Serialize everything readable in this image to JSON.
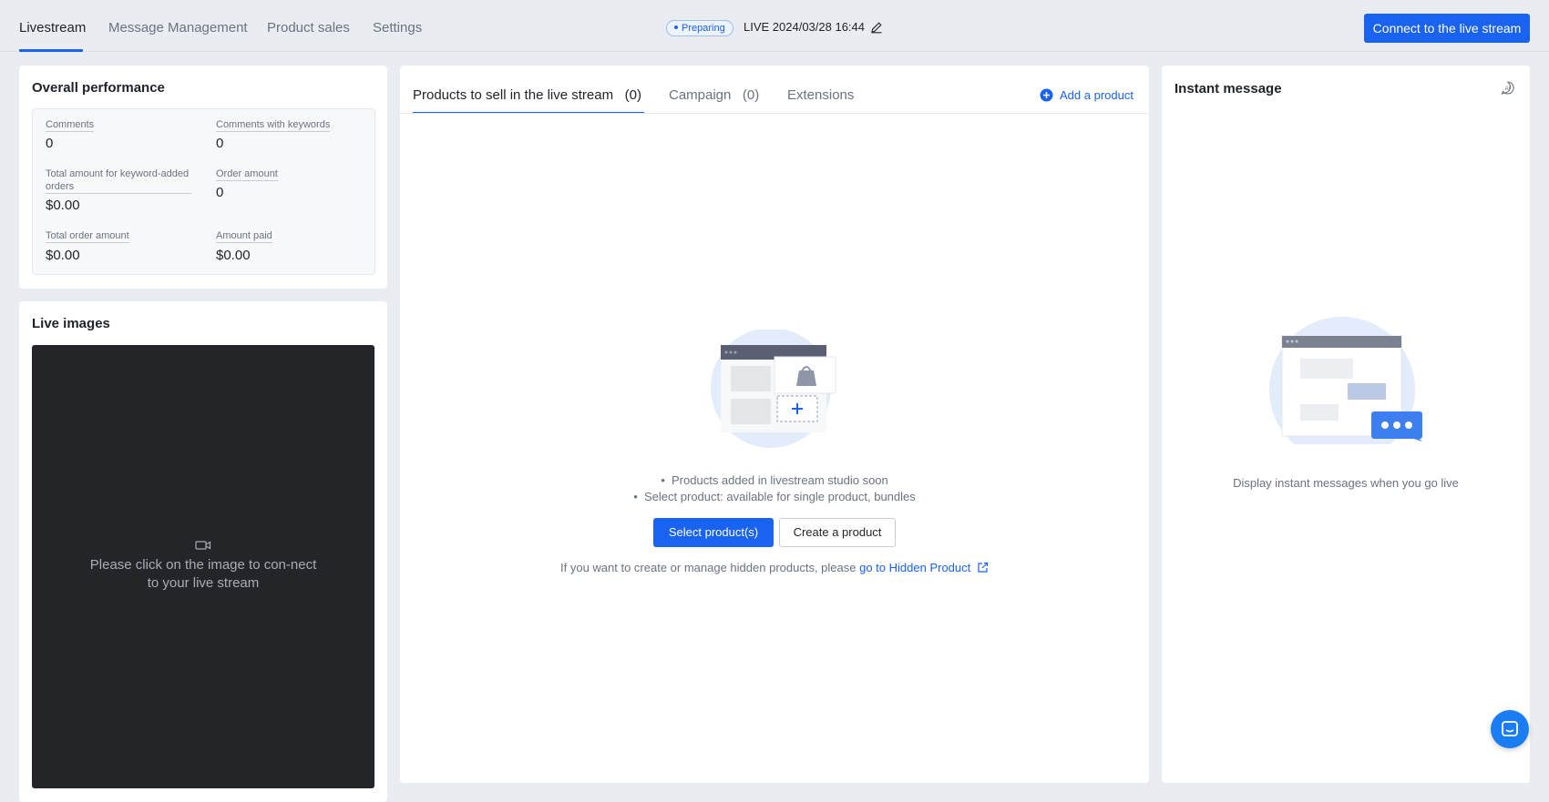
{
  "nav": {
    "tabs": [
      {
        "label": "Livestream",
        "active": true
      },
      {
        "label": "Message Management",
        "active": false
      },
      {
        "label": "Product sales",
        "active": false
      },
      {
        "label": "Settings",
        "active": false
      }
    ],
    "status_badge": "Preparing",
    "live_time": "LIVE 2024/03/28 16:44",
    "connect_button": "Connect to the live stream"
  },
  "performance": {
    "title": "Overall performance",
    "metrics": [
      {
        "label": "Comments",
        "value": "0"
      },
      {
        "label": "Comments with keywords",
        "value": "0"
      },
      {
        "label": "Total amount for keyword-added orders",
        "value": "$0.00"
      },
      {
        "label": "Order amount",
        "value": "0"
      },
      {
        "label": "Total order amount",
        "value": "$0.00"
      },
      {
        "label": "Amount paid",
        "value": "$0.00"
      }
    ]
  },
  "live_images": {
    "title": "Live images",
    "placeholder": "Please click on the image to con-nect to your live stream"
  },
  "products": {
    "tabs": [
      {
        "label": "Products to sell in the live stream",
        "count": "(0)"
      },
      {
        "label": "Campaign",
        "count": "(0)"
      },
      {
        "label": "Extensions",
        "count": ""
      }
    ],
    "add_link": "Add a product",
    "bullets": [
      "Products added in livestream studio soon",
      "Select product: available for single product, bundles"
    ],
    "select_button": "Select product(s)",
    "create_button": "Create a product",
    "hidden_text": "If you want to create or manage hidden products, please",
    "hidden_link": "go to Hidden Product"
  },
  "instant_message": {
    "title": "Instant message",
    "empty_text": "Display instant messages when you go live"
  },
  "colors": {
    "accent": "#1a62f0",
    "background": "#e9ecf1",
    "video_bg": "#232529"
  },
  "icons": [
    "edit-icon",
    "plus-circle-icon",
    "video-camera-icon",
    "external-link-icon",
    "ai-icon",
    "chat-icon"
  ]
}
